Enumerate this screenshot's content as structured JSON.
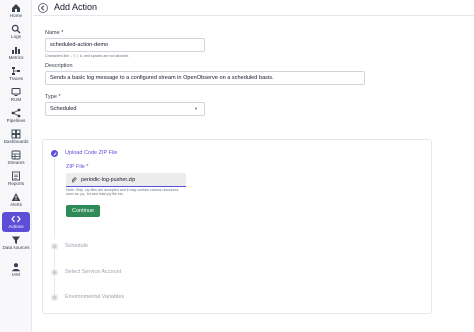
{
  "sidebar": {
    "items": [
      {
        "label": "Home",
        "icon": "home-icon"
      },
      {
        "label": "Logs",
        "icon": "search-icon"
      },
      {
        "label": "Metrics",
        "icon": "bar-chart-icon"
      },
      {
        "label": "Traces",
        "icon": "traces-icon"
      },
      {
        "label": "RUM",
        "icon": "monitor-icon"
      },
      {
        "label": "Pipelines",
        "icon": "pipelines-icon"
      },
      {
        "label": "Dashboards",
        "icon": "dashboards-icon"
      },
      {
        "label": "Streams",
        "icon": "streams-icon"
      },
      {
        "label": "Reports",
        "icon": "reports-icon"
      },
      {
        "label": "Alerts",
        "icon": "alert-icon"
      },
      {
        "label": "Actions",
        "icon": "code-icon",
        "active": true
      },
      {
        "label": "Data sources",
        "icon": "filter-icon"
      },
      {
        "label": "IAM",
        "icon": "user-icon"
      }
    ],
    "active_color": "#5b4fd8"
  },
  "header": {
    "title": "Add Action"
  },
  "form": {
    "name_label": "Name *",
    "name_value": "scheduled-action-demo",
    "name_hint": "Characters like :, ?, /, #, and spaces are not allowed.",
    "description_label": "Description",
    "description_value": "Sends a basic log message to a configured stream in OpenObserve on a scheduled basis.",
    "type_label": "Type *",
    "type_value": "Scheduled"
  },
  "stepper": {
    "steps": [
      {
        "title": "Upload Code ZIP File",
        "state": "active"
      },
      {
        "title": "Schedule",
        "state": "inactive"
      },
      {
        "title": "Select Service Account",
        "state": "inactive"
      },
      {
        "title": "Environmental Variables",
        "state": "inactive"
      }
    ],
    "zip_label": "ZIP File *",
    "zip_file": "periodic-log-pusher.zip",
    "zip_note": "Note: Only .zip files are accepted and it may contain various resources such as .py, .txt and main.py file etc.",
    "continue_label": "Continue",
    "continue_color": "#2e8b57"
  }
}
